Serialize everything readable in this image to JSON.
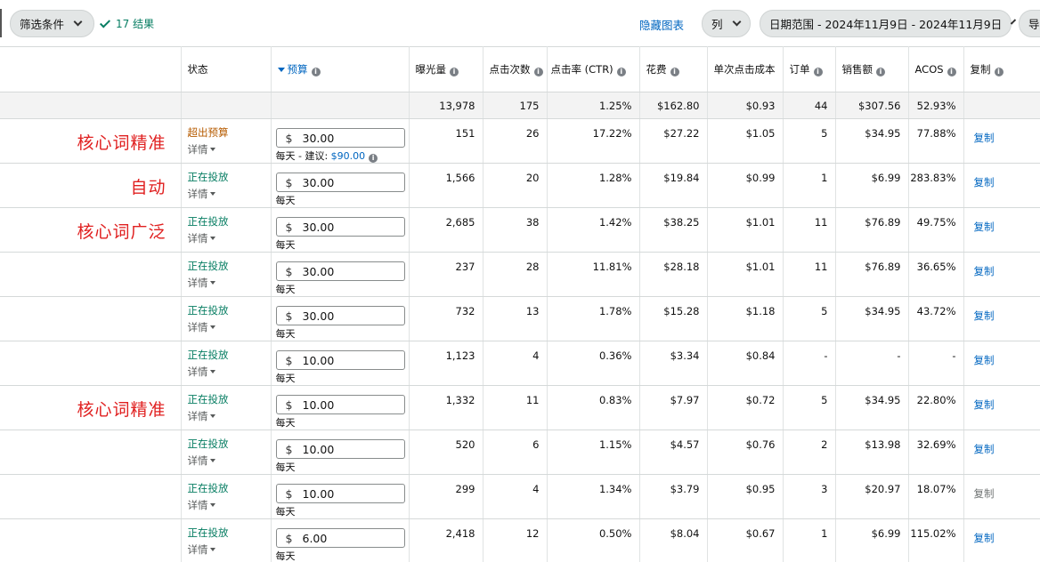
{
  "toolbar": {
    "filter_label": "筛选条件",
    "results_label": "17 结果",
    "hide_chart_label": "隐藏图表",
    "columns_label": "列",
    "date_range_label": "日期范围 - 2024年11月9日 - 2024年11月9日",
    "export_label": "导"
  },
  "columns": {
    "status": "状态",
    "budget": "预算",
    "impressions": "曝光量",
    "clicks": "点击次数",
    "ctr": "点击率 (CTR)",
    "spend": "花费",
    "cpc": "单次点击成本",
    "orders": "订单",
    "sales": "销售额",
    "acos": "ACOS",
    "copy": "复制"
  },
  "summary": {
    "impressions": "13,978",
    "clicks": "175",
    "ctr": "1.25%",
    "spend": "$162.80",
    "cpc": "$0.93",
    "orders": "44",
    "sales": "$307.56",
    "acos": "52.93%"
  },
  "labels": {
    "currency": "$",
    "detail": "详情",
    "daily": "每天",
    "suggest_prefix": "每天 - 建议: ",
    "copy": "复制"
  },
  "colors": {
    "annotation": "#e02020",
    "status_over": "#b65b00",
    "status_live": "#067d62",
    "link": "#0066c0"
  },
  "rows": [
    {
      "annotation": "核心词精准",
      "status": "超出预算",
      "status_type": "over",
      "budget": "30.00",
      "suggested": "$90.00",
      "impressions": "151",
      "clicks": "26",
      "ctr": "17.22%",
      "spend": "$27.22",
      "cpc": "$1.05",
      "orders": "5",
      "sales": "$34.95",
      "acos": "77.88%",
      "copy_active": true
    },
    {
      "annotation": "自动",
      "status": "正在投放",
      "status_type": "live",
      "budget": "30.00",
      "suggested": "",
      "impressions": "1,566",
      "clicks": "20",
      "ctr": "1.28%",
      "spend": "$19.84",
      "cpc": "$0.99",
      "orders": "1",
      "sales": "$6.99",
      "acos": "283.83%",
      "copy_active": true
    },
    {
      "annotation": "核心词广泛",
      "status": "正在投放",
      "status_type": "live",
      "budget": "30.00",
      "suggested": "",
      "impressions": "2,685",
      "clicks": "38",
      "ctr": "1.42%",
      "spend": "$38.25",
      "cpc": "$1.01",
      "orders": "11",
      "sales": "$76.89",
      "acos": "49.75%",
      "copy_active": true
    },
    {
      "annotation": "",
      "status": "正在投放",
      "status_type": "live",
      "budget": "30.00",
      "suggested": "",
      "impressions": "237",
      "clicks": "28",
      "ctr": "11.81%",
      "spend": "$28.18",
      "cpc": "$1.01",
      "orders": "11",
      "sales": "$76.89",
      "acos": "36.65%",
      "copy_active": true
    },
    {
      "annotation": "",
      "status": "正在投放",
      "status_type": "live",
      "budget": "30.00",
      "suggested": "",
      "impressions": "732",
      "clicks": "13",
      "ctr": "1.78%",
      "spend": "$15.28",
      "cpc": "$1.18",
      "orders": "5",
      "sales": "$34.95",
      "acos": "43.72%",
      "copy_active": true
    },
    {
      "annotation": "",
      "status": "正在投放",
      "status_type": "live",
      "budget": "10.00",
      "suggested": "",
      "impressions": "1,123",
      "clicks": "4",
      "ctr": "0.36%",
      "spend": "$3.34",
      "cpc": "$0.84",
      "orders": "-",
      "sales": "-",
      "acos": "-",
      "copy_active": true
    },
    {
      "annotation": "核心词精准",
      "status": "正在投放",
      "status_type": "live",
      "budget": "10.00",
      "suggested": "",
      "impressions": "1,332",
      "clicks": "11",
      "ctr": "0.83%",
      "spend": "$7.97",
      "cpc": "$0.72",
      "orders": "5",
      "sales": "$34.95",
      "acos": "22.80%",
      "copy_active": true
    },
    {
      "annotation": "",
      "status": "正在投放",
      "status_type": "live",
      "budget": "10.00",
      "suggested": "",
      "impressions": "520",
      "clicks": "6",
      "ctr": "1.15%",
      "spend": "$4.57",
      "cpc": "$0.76",
      "orders": "2",
      "sales": "$13.98",
      "acos": "32.69%",
      "copy_active": true
    },
    {
      "annotation": "",
      "status": "正在投放",
      "status_type": "live",
      "budget": "10.00",
      "suggested": "",
      "impressions": "299",
      "clicks": "4",
      "ctr": "1.34%",
      "spend": "$3.79",
      "cpc": "$0.95",
      "orders": "3",
      "sales": "$20.97",
      "acos": "18.07%",
      "copy_active": false
    },
    {
      "annotation": "",
      "status": "正在投放",
      "status_type": "live",
      "budget": "6.00",
      "suggested": "",
      "impressions": "2,418",
      "clicks": "12",
      "ctr": "0.50%",
      "spend": "$8.04",
      "cpc": "$0.67",
      "orders": "1",
      "sales": "$6.99",
      "acos": "115.02%",
      "copy_active": true
    }
  ]
}
